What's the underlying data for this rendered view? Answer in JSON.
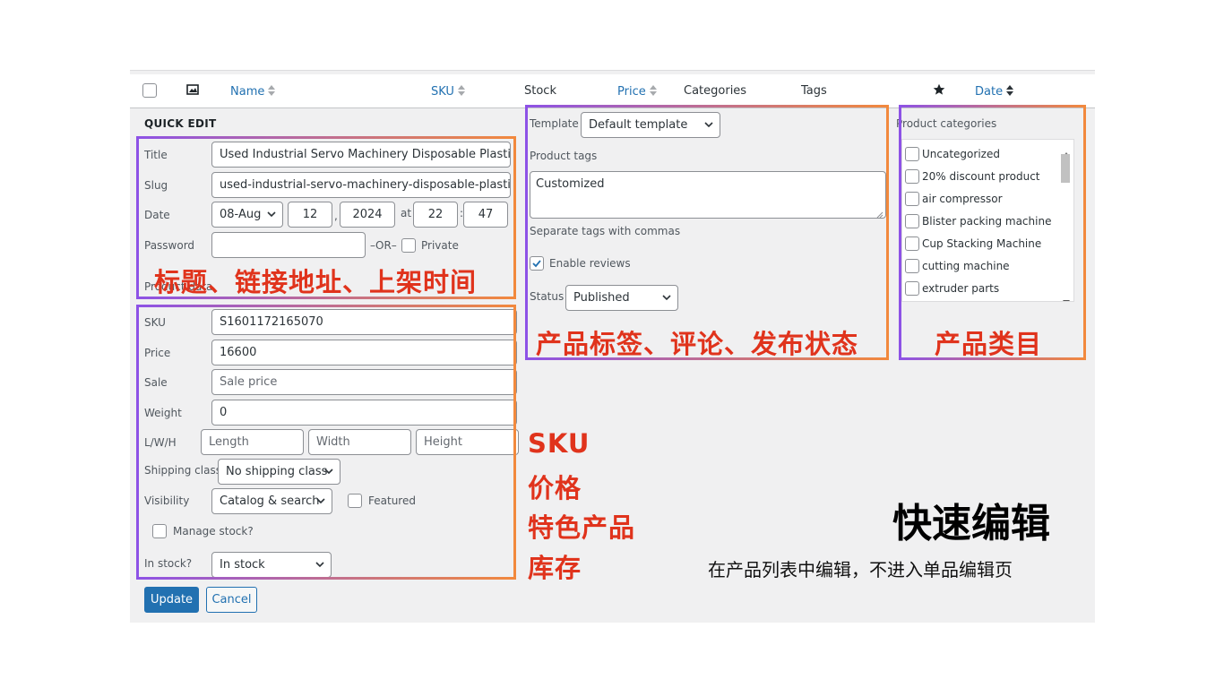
{
  "table_header": {
    "name": "Name",
    "sku": "SKU",
    "stock": "Stock",
    "price": "Price",
    "categories": "Categories",
    "tags": "Tags",
    "date": "Date",
    "image_icon": "image-icon",
    "featured_icon": "star-icon"
  },
  "quick_edit": {
    "heading": "QUICK EDIT",
    "title_label": "Title",
    "title_value": "Used Industrial Servo Machinery Disposable Plastic Cc",
    "slug_label": "Slug",
    "slug_value": "used-industrial-servo-machinery-disposable-plastic-cc",
    "date_label": "Date",
    "date_month": "08-Aug",
    "date_day": "12",
    "date_comma": ",",
    "date_year": "2024",
    "date_at": "at",
    "date_hour": "22",
    "date_colon": ":",
    "date_minute": "47",
    "password_label": "Password",
    "password_value": "",
    "or_text": "–OR–",
    "private_label": "Private",
    "product_data_label": "Product data",
    "sku_label": "SKU",
    "sku_value": "S1601172165070",
    "price_label": "Price",
    "price_value": "16600",
    "sale_label": "Sale",
    "sale_placeholder": "Sale price",
    "weight_label": "Weight",
    "weight_value": "0",
    "lwh_label": "L/W/H",
    "length_placeholder": "Length",
    "width_placeholder": "Width",
    "height_placeholder": "Height",
    "shipping_label": "Shipping class",
    "shipping_value": "No shipping class",
    "visibility_label": "Visibility",
    "visibility_value": "Catalog & search",
    "featured_label": "Featured",
    "manage_stock_label": "Manage stock?",
    "in_stock_label": "In stock?",
    "in_stock_value": "In stock",
    "update_button": "Update",
    "cancel_button": "Cancel"
  },
  "middle": {
    "template_label": "Template",
    "template_value": "Default template",
    "tags_label": "Product tags",
    "tags_value": "Customized",
    "tags_hint": "Separate tags with commas",
    "enable_reviews_label": "Enable reviews",
    "enable_reviews_checked": true,
    "status_label": "Status",
    "status_value": "Published"
  },
  "categories": {
    "heading": "Product categories",
    "items": [
      "Uncategorized",
      "20% discount product",
      "air compressor",
      "Blister packing machine",
      "Cup Stacking Machine",
      "cutting machine",
      "extruder parts"
    ]
  },
  "annotations": {
    "box1": "标题、链接地址、上架时间",
    "box2": "产品标签、评论、发布状态",
    "box3": "产品类目",
    "box4_lines": [
      "SKU",
      "价格",
      "特色产品",
      "库存"
    ],
    "main_title": "快速编辑",
    "subtitle": "在产品列表中编辑，不进入单品编辑页"
  },
  "colors": {
    "accent": "#2271b1",
    "annotation_red": "#e0331c",
    "frame_purple": "#8d52e6",
    "frame_orange": "#f2893d"
  }
}
